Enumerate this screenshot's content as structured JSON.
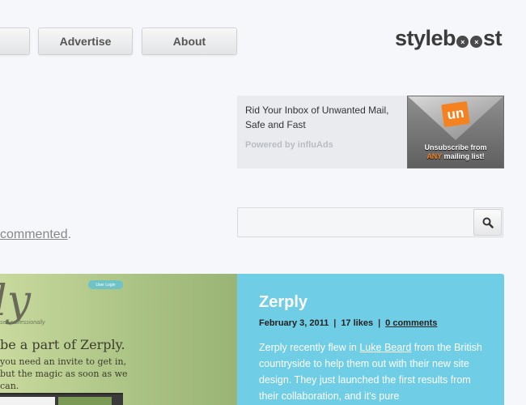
{
  "nav": {
    "items": [
      {
        "label": ""
      },
      {
        "label": "Advertise"
      },
      {
        "label": "About"
      }
    ]
  },
  "logo": {
    "pre": "styleb",
    "o1": "×",
    "o2": "×",
    "post": "st"
  },
  "ad": {
    "text": "Rid Your Inbox of Unwanted Mail, Safe and Fast",
    "powered": "Powered by influAds",
    "image_logo": "un",
    "image_caption_1": "Unsubscribe from",
    "image_caption_any": "ANY",
    "image_caption_2": " mailing list!"
  },
  "search": {
    "placeholder": "",
    "value": ""
  },
  "comment_link": {
    "text": "commented",
    "suffix": "."
  },
  "screenshot": {
    "logo_text": "ly",
    "login_label": "User Login",
    "tagline": "self professionally",
    "heading": "be a part of Zerply.",
    "body": "you need an invite to get in, but the magic as soon as we can."
  },
  "post": {
    "title": "Zerply",
    "date": "February 3, 2011",
    "likes": "17 likes",
    "comments": "0 comments",
    "body_pre": "Zerply recently flew in ",
    "body_link": "Luke Beard",
    "body_post": " from the British countryside to help them out with their new site design. They just launched the first results from their collaboration, and it's pure"
  },
  "colors": {
    "background": "#f6f7fa",
    "post_accent": "#6fcde5",
    "ad_orange": "#f58220"
  },
  "icons": {
    "search": "search-icon"
  }
}
